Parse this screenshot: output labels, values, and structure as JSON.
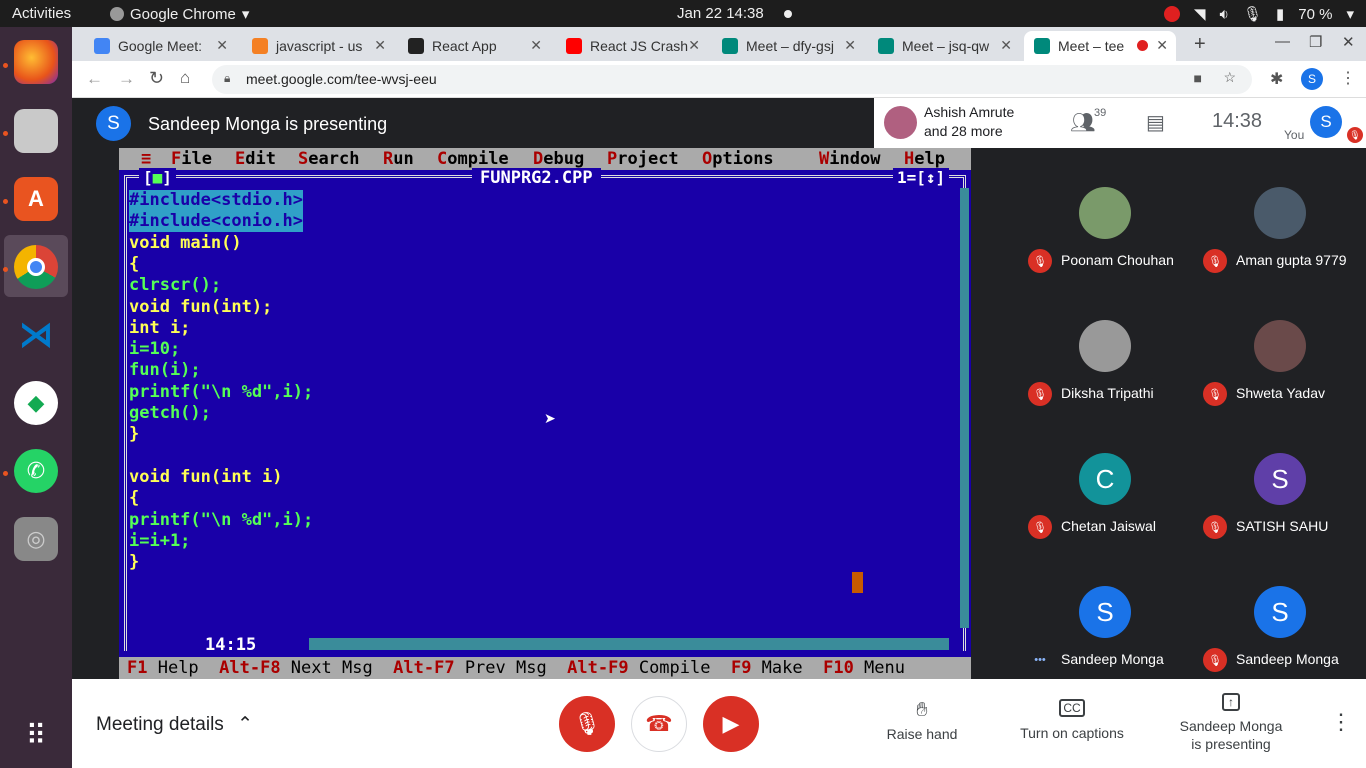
{
  "topbar": {
    "activities": "Activities",
    "app": "Google Chrome",
    "clock": "Jan 22  14:38",
    "battery": "70 %"
  },
  "tabs": [
    {
      "title": "Google Meet:",
      "color": "#4285f4"
    },
    {
      "title": "javascript - us",
      "color": "#f48024"
    },
    {
      "title": "React App",
      "color": "#222"
    },
    {
      "title": "React JS Crash",
      "color": "#f00"
    },
    {
      "title": "Meet – dfy-gsj",
      "color": "#00897b"
    },
    {
      "title": "Meet – jsq-qw",
      "color": "#00897b"
    },
    {
      "title": "Meet – tee",
      "color": "#00897b"
    }
  ],
  "url": "meet.google.com/tee-wvsj-eeu",
  "meet": {
    "presenter_initial": "S",
    "presenting_text": "Sandeep Monga is presenting",
    "host_name": "Ashish Amrute",
    "host_more": "and 28 more",
    "people_count": "39",
    "time": "14:38",
    "you_label": "You",
    "you_initial": "S"
  },
  "turboc": {
    "menu": [
      "≡",
      "File",
      "Edit",
      "Search",
      "Run",
      "Compile",
      "Debug",
      "Project",
      "Options",
      "Window",
      "Help"
    ],
    "filename": "FUNPRG2.CPP",
    "window_num": "1=[↕]",
    "position": "14:15",
    "code": [
      "#include<stdio.h>",
      "#include<conio.h>",
      "void main()",
      "{",
      "clrscr();",
      "void fun(int);",
      "int i;",
      "i=10;",
      "fun(i);",
      "printf(\"\\n %d\",i);",
      "getch();",
      "}",
      "",
      "void fun(int i)",
      "{",
      "printf(\"\\n %d\",i);",
      "i=i+1;",
      "}"
    ],
    "footer": [
      {
        "key": "F1",
        "label": "Help"
      },
      {
        "key": "Alt-F8",
        "label": "Next Msg"
      },
      {
        "key": "Alt-F7",
        "label": "Prev Msg"
      },
      {
        "key": "Alt-F9",
        "label": "Compile"
      },
      {
        "key": "F9",
        "label": "Make"
      },
      {
        "key": "F10",
        "label": "Menu"
      }
    ]
  },
  "participants": [
    {
      "name": "Poonam Chouhan",
      "initial": "",
      "color": "#7a9a6a"
    },
    {
      "name": "Aman gupta 9779",
      "initial": "",
      "color": "#4a5a6a"
    },
    {
      "name": "Diksha Tripathi",
      "initial": "",
      "color": "#999"
    },
    {
      "name": "Shweta Yadav",
      "initial": "",
      "color": "#6a4a4a"
    },
    {
      "name": "Chetan Jaiswal",
      "initial": "C",
      "color": "#12939a"
    },
    {
      "name": "SATISH SAHU",
      "initial": "S",
      "color": "#5f3fa8"
    },
    {
      "name": "Sandeep Monga",
      "initial": "S",
      "color": "#1a73e8"
    },
    {
      "name": "Sandeep Monga",
      "initial": "S",
      "color": "#1a73e8"
    }
  ],
  "bottom": {
    "meeting_details": "Meeting details",
    "raise_hand": "Raise hand",
    "captions": "Turn on captions",
    "presenting_line1": "Sandeep Monga",
    "presenting_line2": "is presenting"
  }
}
